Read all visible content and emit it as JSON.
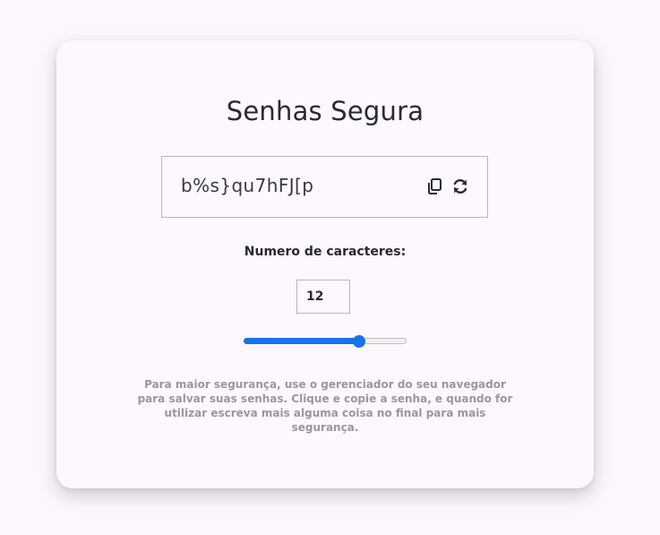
{
  "card": {
    "title": "Senhas Segura",
    "password": {
      "value": "b%s}qu7hFJ[p",
      "copy_icon": "copy-icon",
      "refresh_icon": "refresh-icon"
    },
    "length": {
      "label": "Numero de caracteres:",
      "value": "12",
      "slider_fraction": 0.71
    },
    "note": "Para maior segurança, use o gerenciador do seu navegador para salvar suas senhas. Clique e copie a senha, e quando for utilizar escreva mais alguma coisa no final para mais segurança."
  },
  "colors": {
    "accent": "#1a73e8",
    "background": "#fbf7fc",
    "text": "#2a2833",
    "muted": "#9a96a0"
  }
}
